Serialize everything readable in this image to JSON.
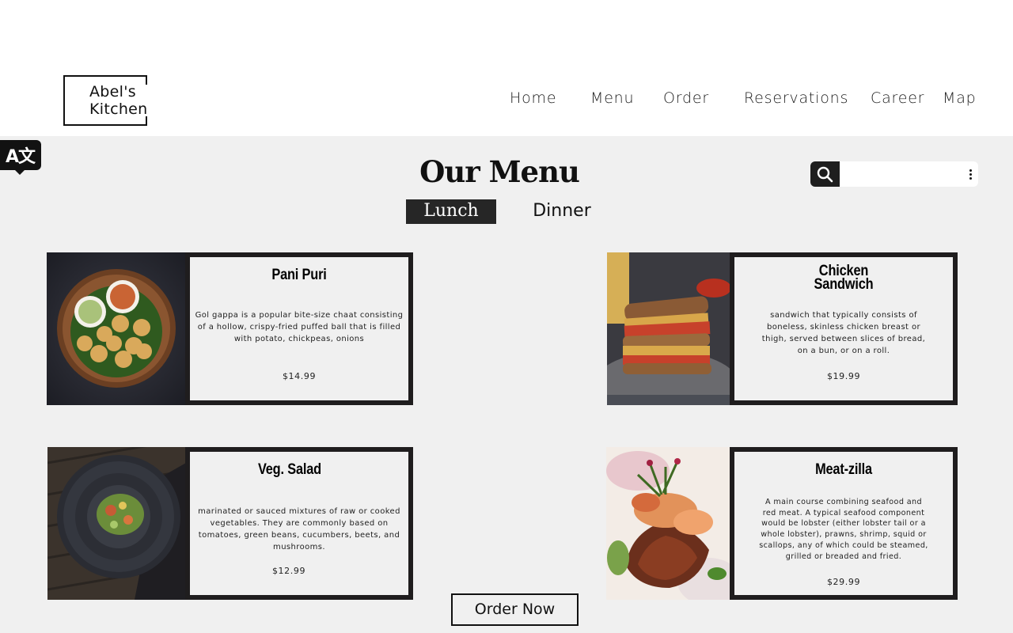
{
  "logo": {
    "text": "Abel's\nKitchen"
  },
  "nav": {
    "home": "Home",
    "menu": "Menu",
    "order": "Order",
    "reservations": "Reservations",
    "career": "Career",
    "map": "Map"
  },
  "translate": {
    "icon": "translate-icon",
    "label": "A文"
  },
  "page_title": "Our Menu",
  "search": {
    "value": "",
    "placeholder": "",
    "icon": "search-icon",
    "more_icon": "more-vertical-icon"
  },
  "tabs": {
    "lunch": "Lunch",
    "dinner": "Dinner",
    "selected": "Lunch"
  },
  "menu_items": [
    {
      "name": "Pani Puri",
      "description": "Gol gappa is a popular bite-size chaat consisting of a hollow, crispy-fried puffed ball that is filled with potato, chickpeas, onions",
      "price": "$14.99"
    },
    {
      "name": "Chicken\nSandwich",
      "description": "sandwich that typically consists of boneless, skinless chicken breast or thigh, served between slices of bread, on a bun, or on a roll.",
      "price": "$19.99"
    },
    {
      "name": "Veg. Salad",
      "description": "marinated or sauced mixtures of raw or cooked vegetables. They are commonly based on tomatoes, green beans, cucumbers, beets, and mushrooms.",
      "price": "$12.99"
    },
    {
      "name": "Meat-zilla",
      "description": "A main course combining seafood and red meat. A typical seafood component would be lobster (either lobster tail or a whole lobster), prawns, shrimp, squid or scallops, any of which could be steamed, grilled or breaded and fried.",
      "price": "$29.99"
    }
  ],
  "order_button": "Order Now",
  "colors": {
    "card_border": "#1f1d1e",
    "active_tab": "#262626",
    "page_bg": "#f0f0f0"
  }
}
